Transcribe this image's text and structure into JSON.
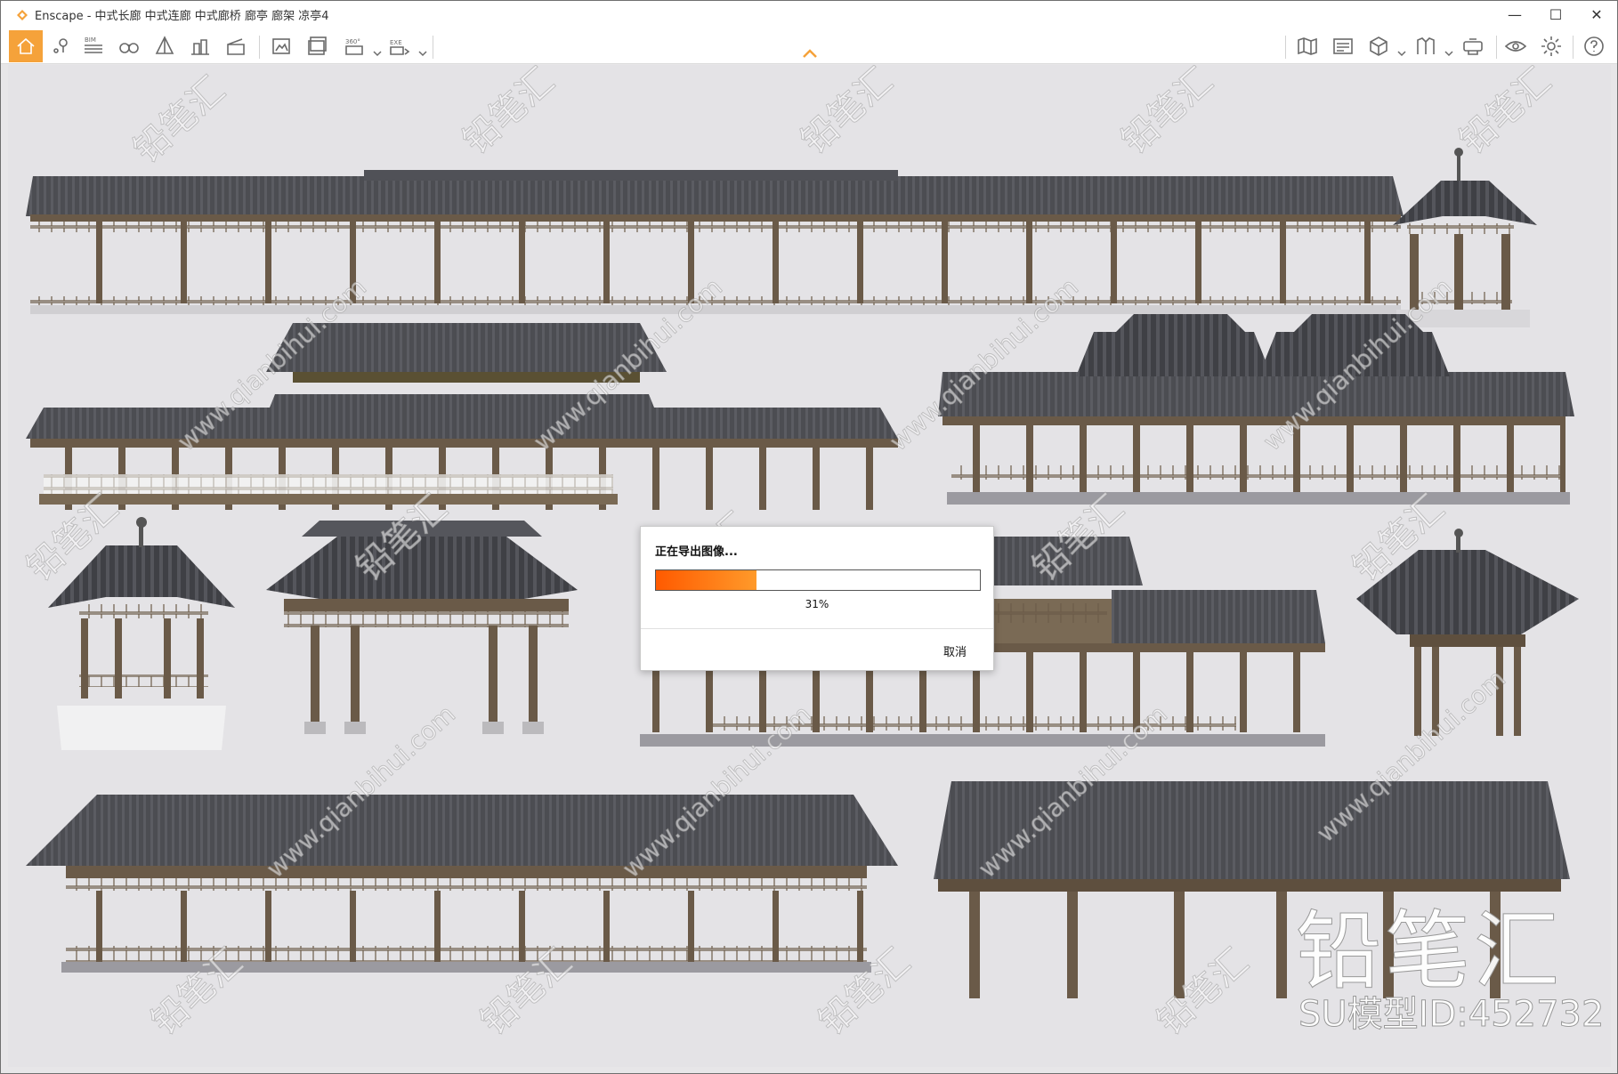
{
  "window": {
    "title": "Enscape - 中式长廊 中式连廊 中式廊桥 廊亭 廊架 凉亭4",
    "controls": [
      "minimize",
      "maximize",
      "close"
    ]
  },
  "toolbar": {
    "bim_label": "BIM",
    "pano_label": "360°",
    "exe_label": "EXE",
    "active_item": "home"
  },
  "dialog": {
    "title": "正在导出图像...",
    "progress": 0.31,
    "percent_text": "31%",
    "cancel_label": "取消"
  },
  "watermark": {
    "brand": "铅笔汇",
    "model_id": "SU模型ID:452732",
    "repeat_text": "铅笔汇",
    "url_text": "www.qianbihui.com"
  },
  "colors": {
    "accent": "#f5a23a",
    "progress_start": "#ff5a00",
    "progress_end": "#ff9a2a",
    "viewport_bg": "#e4e3e6"
  }
}
